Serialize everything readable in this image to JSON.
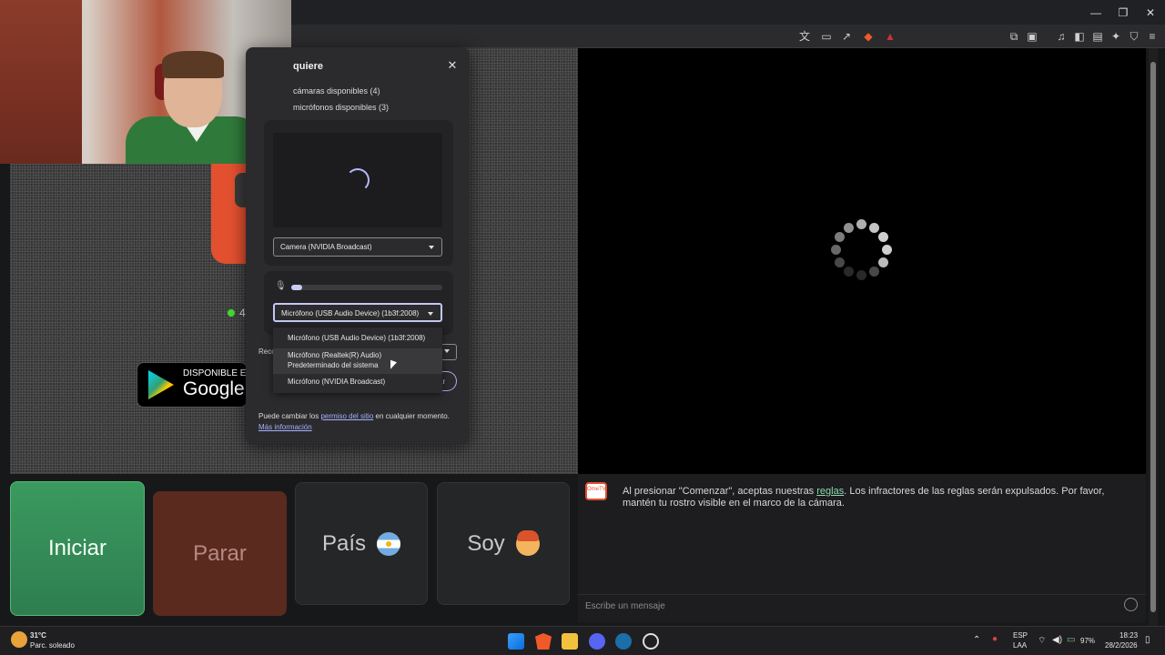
{
  "popup": {
    "title": "quiere",
    "close_glyph": "✕",
    "cameras_available": "cámaras disponibles (4)",
    "mics_available": "micrófonos disponibles (3)",
    "camera_selected": "Camera (NVIDIA Broadcast)",
    "mic_selected": "Micrófono (USB Audio Device) (1b3f:2008)",
    "mic_level": 0.07,
    "rec_label": "Reco",
    "allow_fragment": "ar",
    "dropdown_options": [
      "Micrófono (USB Audio Device) (1b3f:2008)",
      "Micrófono (Realtek(R) Audio)",
      "Predeterminado del sistema",
      "Micrófono (NVIDIA Broadcast)"
    ],
    "footer_pre": "Puede cambiar los ",
    "footer_link": "permiso del sitio",
    "footer_post": " en cualquier momento.",
    "more_info": "Más información"
  },
  "left": {
    "online_count": "4",
    "gplay_top": "DISPONIBLE EN",
    "gplay_big": "Google"
  },
  "buttons": {
    "start": "Iniciar",
    "stop": "Parar",
    "country": "País",
    "iam": "Soy"
  },
  "chat": {
    "logo_text": "OmeTV",
    "msg_pre": "Al presionar \"Comenzar\", aceptas nuestras ",
    "msg_link": "reglas",
    "msg_post": ". Los infractores de las reglas serán expulsados. Por favor, mantén tu rostro visible en el marco de la cámara.",
    "placeholder": "Escribe un mensaje"
  },
  "taskbar": {
    "weather_temp": "31°C",
    "weather_desc": "Parc. soleado",
    "lang_top": "ESP",
    "lang_bottom": "LAA",
    "battery": "97%",
    "time": "18:23",
    "date": "28/2/2026"
  },
  "colors": {
    "start": "#3a9a5e",
    "stop": "#5a2a1f",
    "accent": "#c4c7f5"
  }
}
